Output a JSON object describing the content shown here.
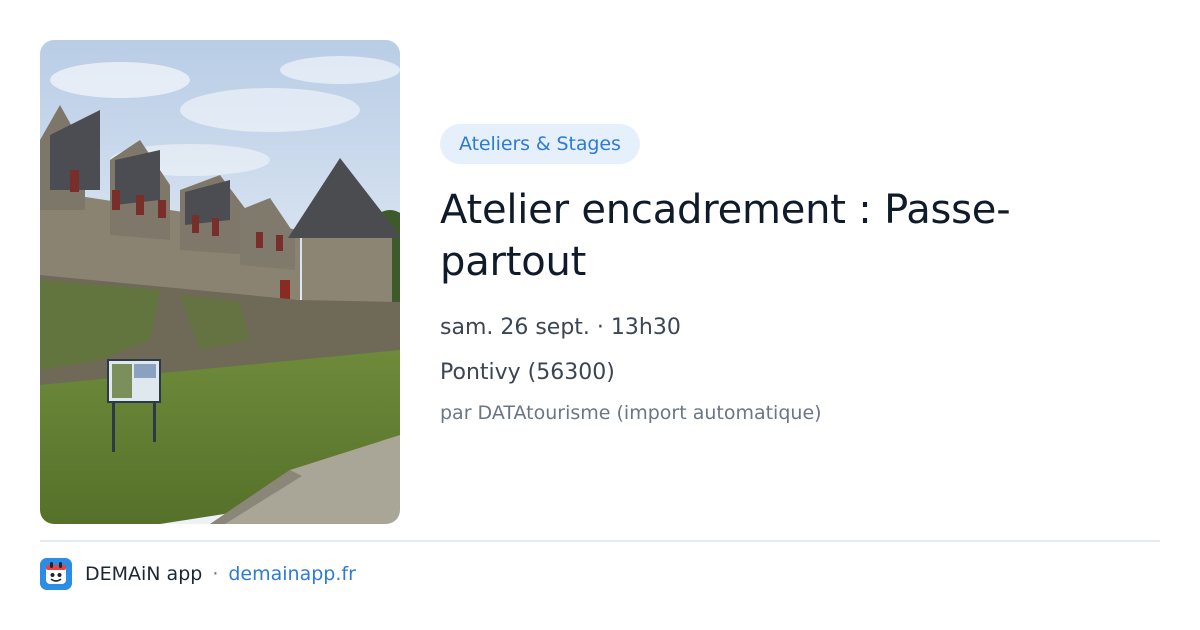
{
  "event": {
    "category": "Ateliers & Stages",
    "title": "Atelier encadrement : Passe-partout",
    "datetime": "sam. 26 sept. · 13h30",
    "location": "Pontivy (56300)",
    "source": "par DATAtourisme (import automatique)"
  },
  "footer": {
    "app_name": "DEMAiN app",
    "separator": "·",
    "url": "demainapp.fr"
  },
  "colors": {
    "accent": "#2e7bd6",
    "category_bg": "#e6f0fc",
    "app_icon": "#2b8de3"
  },
  "icons": {
    "app": "demain-app-icon"
  }
}
